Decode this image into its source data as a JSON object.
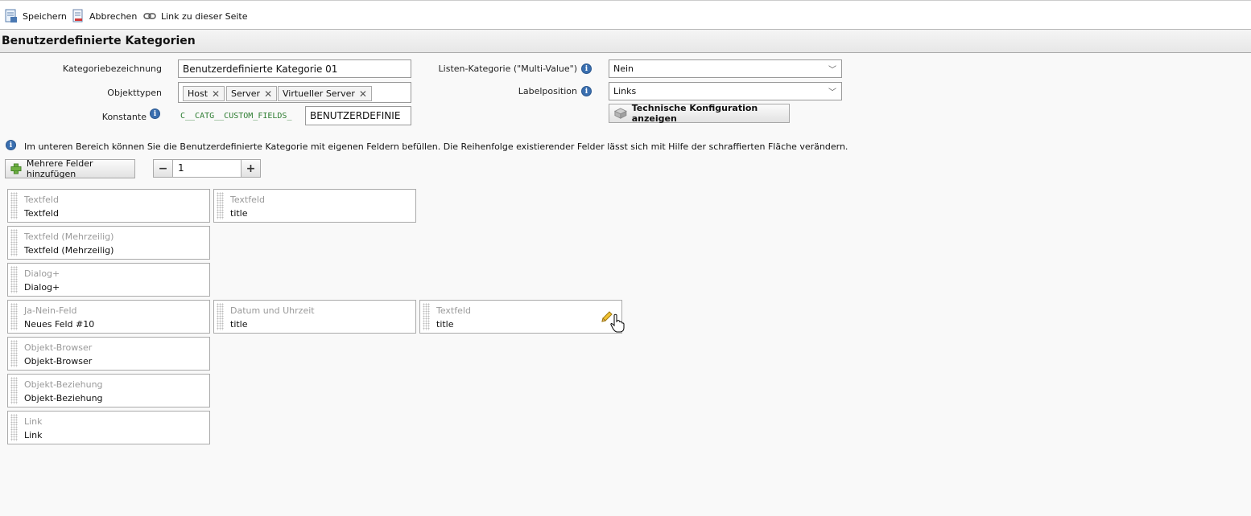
{
  "toolbar": {
    "save": "Speichern",
    "cancel": "Abbrechen",
    "link": "Link zu dieser Seite"
  },
  "header": {
    "title": "Benutzerdefinierte Kategorien"
  },
  "form": {
    "category_label": "Kategoriebezeichnung",
    "category_value": "Benutzerdefinierte Kategorie 01",
    "object_types_label": "Objekttypen",
    "object_types": [
      "Host",
      "Server",
      "Virtueller Server"
    ],
    "constant_label": "Konstante",
    "constant_prefix": "C__CATG__CUSTOM_FIELDS_",
    "constant_value": "BENUTZERDEFINIE",
    "multi_value_label": "Listen-Kategorie (\"Multi-Value\")",
    "multi_value_value": "Nein",
    "label_position_label": "Labelposition",
    "label_position_value": "Links",
    "tech_config_button": "Technische Konfiguration anzeigen"
  },
  "notice": "Im unteren Bereich können Sie die Benutzerdefinierte Kategorie mit eigenen Feldern befüllen. Die Reihenfolge existierender Felder lässt sich mit Hilfe der schraffierten Fläche verändern.",
  "add_fields": {
    "button": "Mehrere Felder hinzufügen",
    "minus": "−",
    "count": "1",
    "plus": "+"
  },
  "fields": [
    {
      "type": "Textfeld",
      "name": "Textfeld"
    },
    {
      "type": "Textfeld",
      "name": "title"
    },
    {
      "type": "Textfeld (Mehrzeilig)",
      "name": "Textfeld (Mehrzeilig)"
    },
    {
      "type": "Dialog+",
      "name": "Dialog+"
    },
    {
      "type": "Ja-Nein-Feld",
      "name": "Neues Feld #10"
    },
    {
      "type": "Datum und Uhrzeit",
      "name": "title"
    },
    {
      "type": "Textfeld",
      "name": "title"
    },
    {
      "type": "Objekt-Browser",
      "name": "Objekt-Browser"
    },
    {
      "type": "Objekt-Beziehung",
      "name": "Objekt-Beziehung"
    },
    {
      "type": "Link",
      "name": "Link"
    }
  ],
  "colors": {
    "accent_green": "#2e7d32",
    "info_blue": "#3a6fb0"
  }
}
